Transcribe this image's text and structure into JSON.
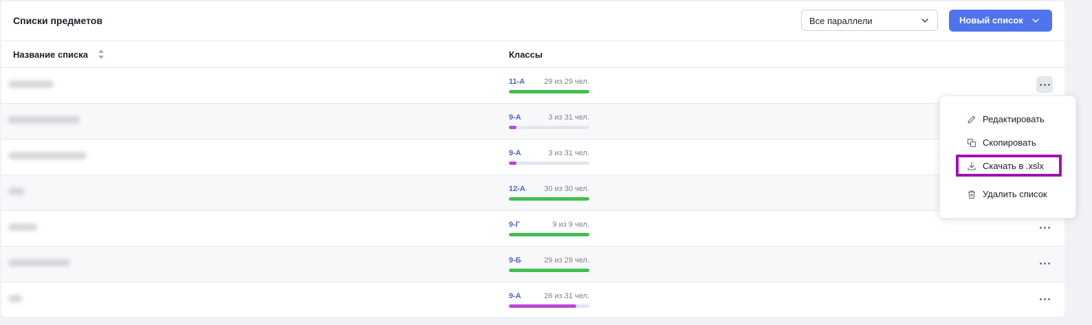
{
  "header": {
    "title": "Списки предметов",
    "filter_value": "Все параллели",
    "new_list_label": "Новый список"
  },
  "table": {
    "columns": [
      "Название списка",
      "Классы"
    ],
    "rows": [
      {
        "class": "11-А",
        "count_text": "29 из 29 чел.",
        "progress": 1.0,
        "color": "#3fbf4f"
      },
      {
        "class": "9-А",
        "count_text": "3 из 31 чел.",
        "progress": 0.097,
        "color": "#b84ad6"
      },
      {
        "class": "9-А",
        "count_text": "3 из 31 чел.",
        "progress": 0.097,
        "color": "#b84ad6"
      },
      {
        "class": "12-А",
        "count_text": "30 из 30 чел.",
        "progress": 1.0,
        "color": "#3fbf4f"
      },
      {
        "class": "9-Г",
        "count_text": "9 из 9 чел.",
        "progress": 1.0,
        "color": "#3fbf4f"
      },
      {
        "class": "9-Б",
        "count_text": "29 из 29 чел.",
        "progress": 1.0,
        "color": "#3fbf4f"
      },
      {
        "class": "9-А",
        "count_text": "26 из 31 чел.",
        "progress": 0.839,
        "color": "#b84ad6"
      }
    ]
  },
  "context_menu": {
    "items": [
      {
        "label": "Редактировать",
        "icon": "pencil-icon"
      },
      {
        "label": "Скопировать",
        "icon": "copy-icon"
      },
      {
        "label": "Скачать в .xslx",
        "icon": "download-icon"
      },
      {
        "label": "Удалить список",
        "icon": "trash-icon"
      }
    ]
  },
  "colors": {
    "accent": "#4f74ec",
    "highlight": "#a30fb5",
    "complete": "#3fbf4f",
    "partial": "#b84ad6"
  }
}
